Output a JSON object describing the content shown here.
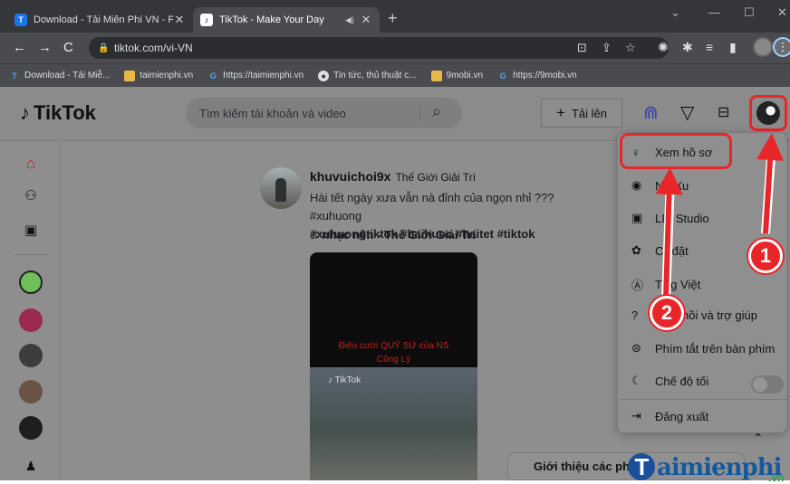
{
  "browser": {
    "tabs": [
      {
        "title": "Download - Tải Miễn Phí VN - Ph",
        "favicon": "T",
        "favicon_color": "#1a73e8"
      },
      {
        "title": "TikTok - Make Your Day",
        "favicon": "♪",
        "favicon_color": "#000000",
        "active": true
      }
    ],
    "url": "tiktok.com/vi-VN",
    "bookmarks": [
      {
        "label": "Download - Tải Miễ...",
        "icon": "T"
      },
      {
        "label": "taimienphi.vn",
        "icon": "folder"
      },
      {
        "label": "https://taimienphi.vn",
        "icon": "G"
      },
      {
        "label": "Tin tức, thủ thuật c...",
        "icon": "globe"
      },
      {
        "label": "9mobi.vn",
        "icon": "folder"
      },
      {
        "label": "https://9mobi.vn",
        "icon": "G"
      }
    ]
  },
  "header": {
    "logo_text": "TikTok",
    "search_placeholder": "Tìm kiếm tài khoản và video",
    "upload_label": "Tải lên"
  },
  "post": {
    "username": "khuvuichoi9x",
    "nickname": "Thế Giới Giải Trí",
    "caption": "Hài tết ngày xưa vẫn nà đỉnh của ngọn nhỉ ??? #xuhuong",
    "tags": "#xuhuongtiktok #haihuoc #haitet #tiktok",
    "music": "nhạc nền - Thế Giới Giải Trí",
    "video_text_1": "Điệu cười QUỶ SỨ của NS",
    "video_text_2": "Công Lý",
    "video_watermark": "TikTok"
  },
  "dropdown": {
    "items": [
      {
        "label": "Xem hồ sơ",
        "icon": "person-icon"
      },
      {
        "label": "Nhận Xu",
        "icon": "coin-icon"
      },
      {
        "label": "LIVE Studio",
        "icon": "live-icon"
      },
      {
        "label": "Cài đặt",
        "icon": "gear-icon"
      },
      {
        "label": "Tiếng Việt",
        "icon": "language-icon"
      },
      {
        "label": "Phản hồi và trợ giúp",
        "icon": "help-icon"
      },
      {
        "label": "Phím tắt trên bàn phím",
        "icon": "keyboard-icon"
      },
      {
        "label": "Chế độ tối",
        "icon": "moon-icon"
      },
      {
        "label": "Đăng xuất",
        "icon": "logout-icon"
      }
    ],
    "visible_labels": [
      "Xem hồ sơ",
      "N",
      "Xu",
      "LI",
      "Studio",
      "Cà",
      "đặt",
      "T",
      "ng Việt",
      "hồi và trợ giúp",
      "Phím tắt trên bàn phím",
      "Chế độ tối",
      "Đăng xuất"
    ]
  },
  "footer_strip": {
    "label": "Giới thiệu các ph"
  },
  "watermark": {
    "text": "aimienphi",
    "initial": "T",
    "suffix": ".vn"
  },
  "annotations": {
    "step1": "1",
    "step2": "2"
  }
}
